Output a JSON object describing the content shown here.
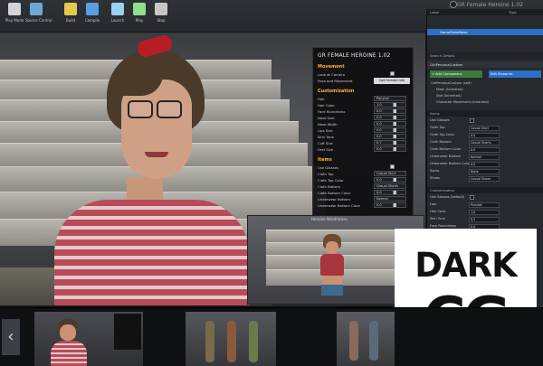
{
  "window": {
    "title": "GR Female Heroine 1.02"
  },
  "toolbar": [
    {
      "label": "Play Mode",
      "icon": "play-settings-icon",
      "color": "#d1d4d8"
    },
    {
      "label": "Source Control",
      "icon": "source-control-icon",
      "color": "#6fa7d6"
    },
    {
      "label": "Build",
      "icon": "build-icon",
      "color": "#e4c84d"
    },
    {
      "label": "Compile",
      "icon": "compile-icon",
      "color": "#5aa0e0"
    },
    {
      "label": "Launch",
      "icon": "launch-icon",
      "color": "#9bd0f0"
    },
    {
      "label": "Play",
      "icon": "play-icon",
      "color": "#8ee08e"
    },
    {
      "label": "Stop",
      "icon": "stop-icon",
      "color": "#c7c7c7"
    }
  ],
  "overlay": {
    "title": "GR FEMALE HEROINE 1.02",
    "movement": {
      "header": "Movement",
      "rows": [
        {
          "label": "Look at Camera",
          "type": "checkbox"
        },
        {
          "label": "Pose and Movement",
          "type": "button",
          "value": "Get Female Idle"
        }
      ]
    },
    "customization": {
      "header": "Customization",
      "rows": [
        {
          "label": "Hair",
          "value": "Ponytail"
        },
        {
          "label": "Hair Color",
          "value": "1.0"
        },
        {
          "label": "Face Roundness",
          "value": "0.0"
        },
        {
          "label": "Nose Size",
          "value": "0.0"
        },
        {
          "label": "Nose Width",
          "value": "0.0"
        },
        {
          "label": "Lips Size",
          "value": "0.0"
        },
        {
          "label": "Skin Tone",
          "value": "0.0"
        },
        {
          "label": "Cuff Size",
          "value": "0.7"
        },
        {
          "label": "Feet Size",
          "value": "0.0"
        }
      ]
    },
    "items": {
      "header": "Items",
      "rows": [
        {
          "label": "Use Glasses",
          "type": "checkbox"
        },
        {
          "label": "Cloth Top",
          "value": "Casual Shirt"
        },
        {
          "label": "Cloth Top Color",
          "value": "0.0"
        },
        {
          "label": "Cloth Bottom",
          "value": "Casual Shorts"
        },
        {
          "label": "Cloth Bottom Color",
          "value": "0.0"
        },
        {
          "label": "Underwear Bottom",
          "value": "Normal"
        },
        {
          "label": "Underwear Bottom Color",
          "value": "0.0"
        }
      ]
    }
  },
  "inset": {
    "title": "Heroine Wireframes"
  },
  "details_panel": {
    "outliner_header": "Label",
    "type_header": "Type",
    "selected_item": "GameStateBase",
    "search_placeholder": "Search Details",
    "actor_name": "GirlPersonaCustom",
    "add_component": "+ Add Component",
    "edit_blueprint": "Edit Blueprint",
    "components": [
      "GirlPersonaCustom (self)",
      "Mesh (Inherited)",
      "Skel (Inherited)",
      "Character Movement (Inherited)"
    ],
    "sections": [
      {
        "header": "Items",
        "rows": [
          {
            "label": "Use Glasses",
            "type": "checkbox"
          },
          {
            "label": "Cloth Top",
            "value": "Casual Shirt"
          },
          {
            "label": "Cloth Top Color",
            "value": "0.0"
          },
          {
            "label": "Cloth Bottom",
            "value": "Casual Shorts"
          },
          {
            "label": "Cloth Bottom Color",
            "value": "0.0"
          },
          {
            "label": "Underwear Bottom",
            "value": "Normal"
          },
          {
            "label": "Underwear Bottom Color",
            "value": "0.0"
          },
          {
            "label": "Socks",
            "value": "None"
          },
          {
            "label": "Shoes",
            "value": "Casual Shoes"
          }
        ]
      },
      {
        "header": "Customization",
        "rows": [
          {
            "label": "Use Glasses (default)",
            "type": "checkbox"
          },
          {
            "label": "Hair",
            "value": "Ponytail"
          },
          {
            "label": "Hair Color",
            "value": "1.0"
          },
          {
            "label": "Skin Tone",
            "value": "0.5"
          },
          {
            "label": "Face Roundness",
            "value": "0.0"
          },
          {
            "label": "Nose Size",
            "value": "0.0"
          },
          {
            "label": "Lips Size",
            "value": "0.0"
          }
        ]
      }
    ]
  },
  "watermark": {
    "line1": "DARK",
    "line2": "CG"
  },
  "filmstrip": {
    "prev_glyph": "‹"
  },
  "colors": {
    "accent_orange": "#ffb23a",
    "selection_blue": "#2b6fc7",
    "panel_bg": "#26292d",
    "shirt_red": "#b84b5a"
  }
}
